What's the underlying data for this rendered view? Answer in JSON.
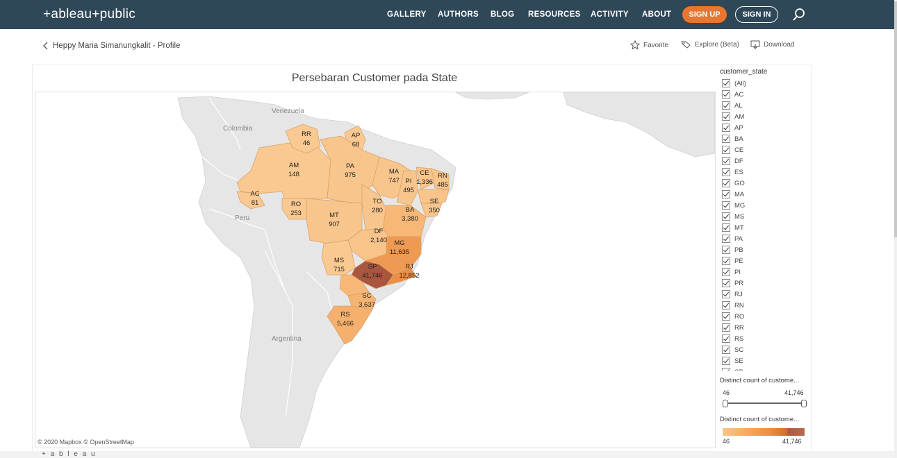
{
  "header": {
    "logo_text": "+ableau+public",
    "nav": [
      "GALLERY",
      "AUTHORS",
      "BLOG",
      "RESOURCES",
      "ACTIVITY",
      "ABOUT"
    ],
    "signup_label": "SIGN UP",
    "signin_label": "SIGN IN"
  },
  "breadcrumb": {
    "label": "Heppy Maria Simanungkalit - Profile"
  },
  "actions": {
    "favorite": "Favorite",
    "explore": "Explore (Beta)",
    "download": "Download"
  },
  "viz": {
    "title": "Persebaran Customer pada State",
    "copyright": "© 2020 Mapbox  © OpenStreetMap",
    "map_labels": [
      "Venezuela",
      "Colombia",
      "Peru",
      "Argentina"
    ],
    "states": [
      {
        "code": "RR",
        "value": "46"
      },
      {
        "code": "AP",
        "value": "68"
      },
      {
        "code": "AM",
        "value": "148"
      },
      {
        "code": "PA",
        "value": "975"
      },
      {
        "code": "MA",
        "value": "747"
      },
      {
        "code": "CE",
        "value": "1,336"
      },
      {
        "code": "RN",
        "value": "485"
      },
      {
        "code": "PI",
        "value": "495"
      },
      {
        "code": "AC",
        "value": "81"
      },
      {
        "code": "RO",
        "value": "253"
      },
      {
        "code": "TO",
        "value": "280"
      },
      {
        "code": "SE",
        "value": "350"
      },
      {
        "code": "MT",
        "value": "907"
      },
      {
        "code": "BA",
        "value": "3,380"
      },
      {
        "code": "DF",
        "value": "2,140"
      },
      {
        "code": "MG",
        "value": "11,635"
      },
      {
        "code": "MS",
        "value": "715"
      },
      {
        "code": "SP",
        "value": "41,746"
      },
      {
        "code": "RJ",
        "value": "12,852"
      },
      {
        "code": "SC",
        "value": "3,637"
      },
      {
        "code": "RS",
        "value": "5,466"
      }
    ]
  },
  "filter": {
    "title": "customer_state",
    "options": [
      "(All)",
      "AC",
      "AL",
      "AM",
      "AP",
      "BA",
      "CE",
      "DF",
      "ES",
      "GO",
      "MA",
      "MG",
      "MS",
      "MT",
      "PA",
      "PB",
      "PE",
      "PI",
      "PR",
      "RJ",
      "RN",
      "RO",
      "RR",
      "RS",
      "SC",
      "SE",
      "SP"
    ]
  },
  "size_legend": {
    "title": "Distinct count of custome...",
    "min": "46",
    "max": "41,746"
  },
  "color_legend": {
    "title": "Distinct count of custome...",
    "min": "46",
    "max": "41,746"
  },
  "footer": {
    "logo_text": "+ a b l e a u"
  },
  "colors": {
    "header_bg": "#2f4858",
    "accent": "#e8762d",
    "low": "#f9c98f",
    "high": "#a0503d"
  }
}
